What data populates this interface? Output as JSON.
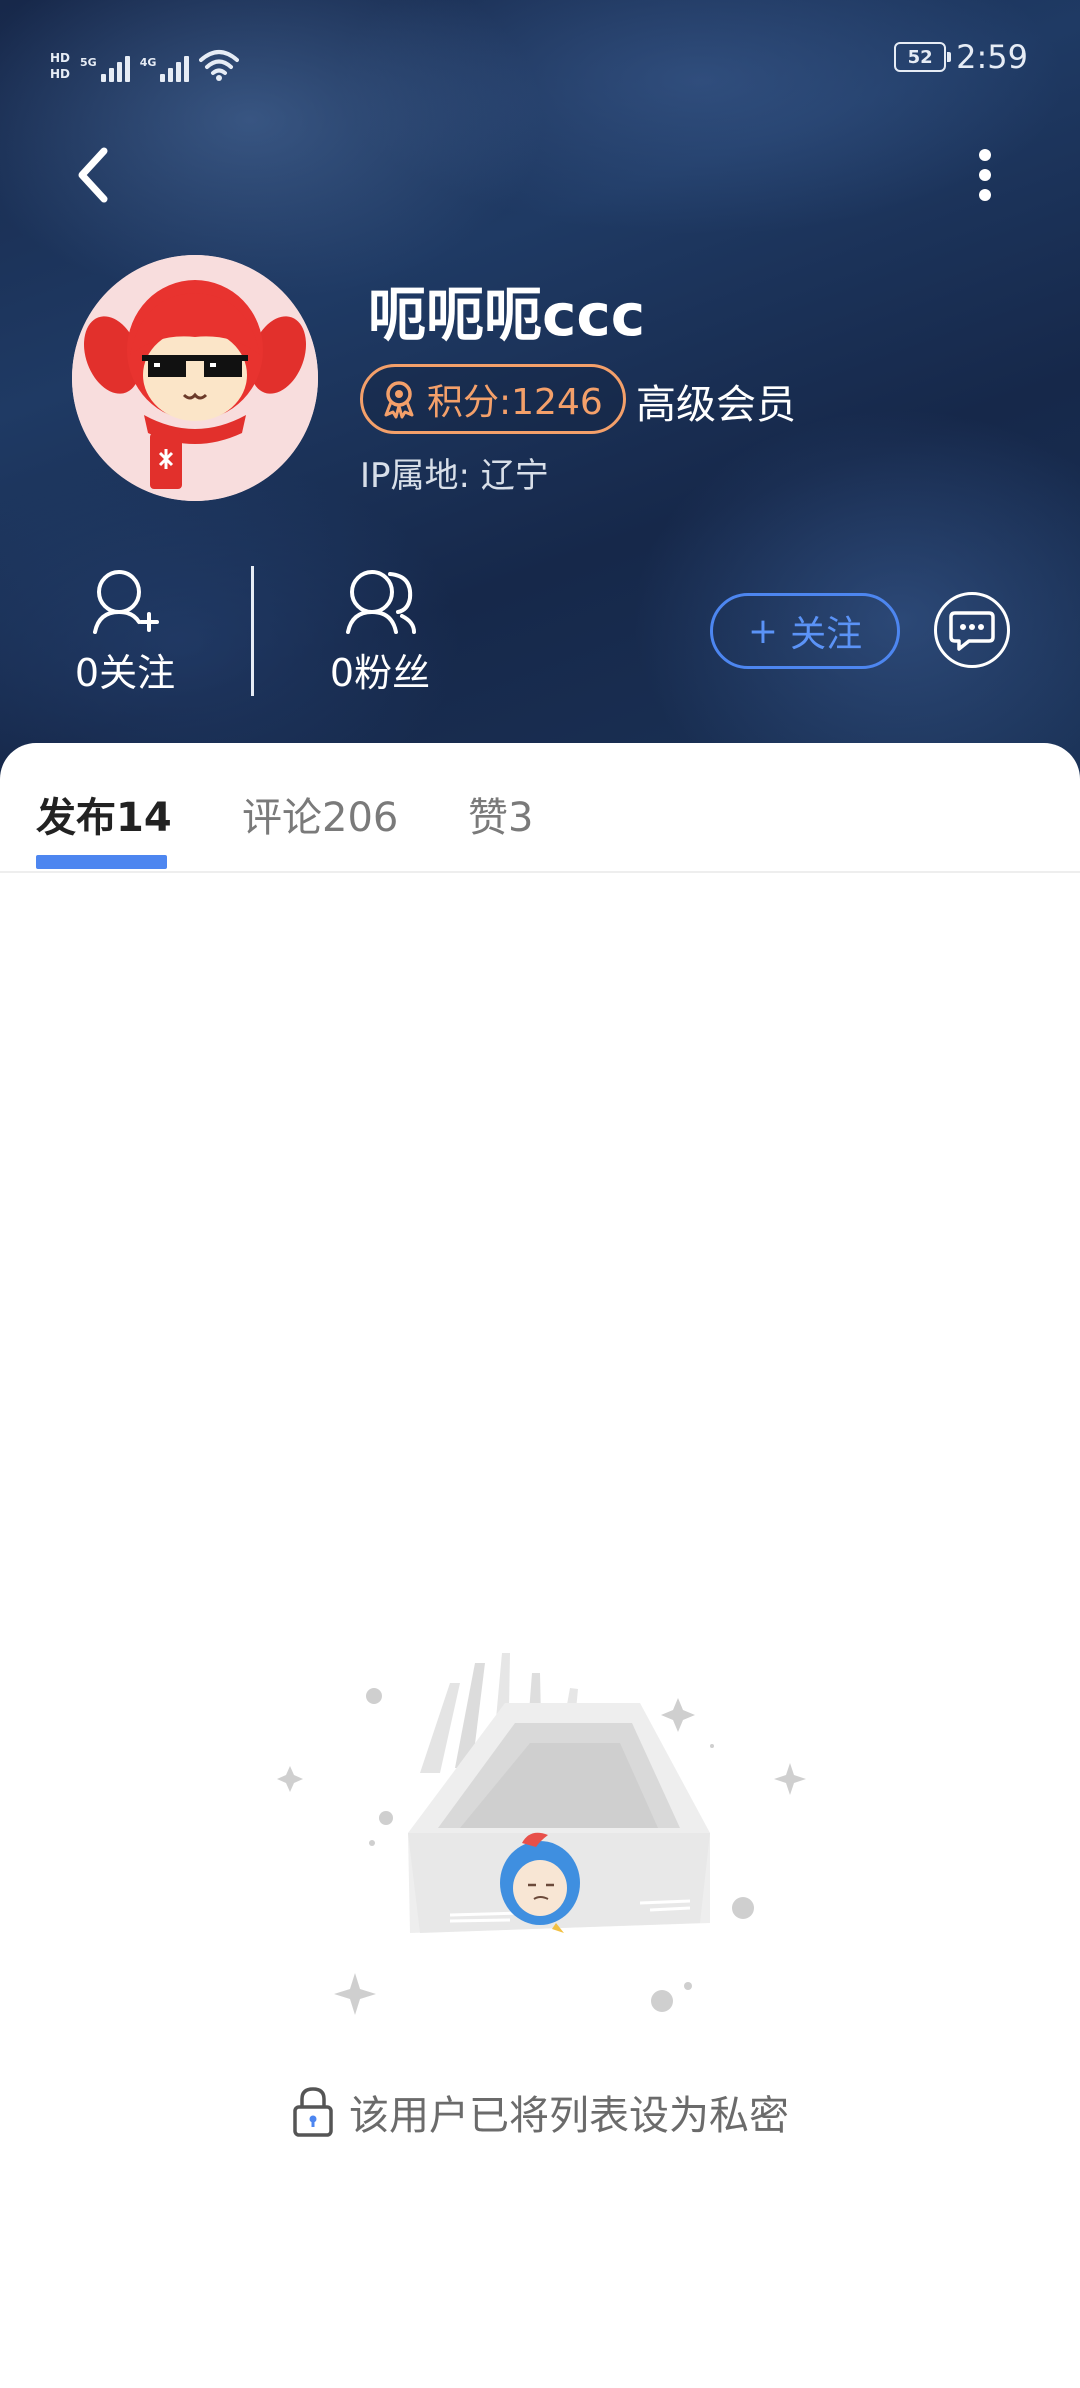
{
  "status_bar": {
    "hd_tags": [
      "HD",
      "HD"
    ],
    "sim1_network": "5G",
    "sim2_network": "4G",
    "battery": "52",
    "time": "2:59",
    "icons": [
      "signal-icon",
      "wifi-icon",
      "battery-icon"
    ]
  },
  "nav": {
    "back_icon": "chevron-left-icon",
    "more_icon": "more-vertical-icon"
  },
  "profile": {
    "username": "呃呃呃ccc",
    "points_label": "积分:1246",
    "member_level": "高级会员",
    "ip_location": "IP属地: 辽宁",
    "avatar_icon": "avatar"
  },
  "stats": {
    "following": "0关注",
    "fans": "0粉丝"
  },
  "actions": {
    "follow_plus": "+",
    "follow_label": "关注",
    "message_icon": "chat-bubble-icon"
  },
  "tabs": [
    {
      "label": "发布14",
      "active": true
    },
    {
      "label": "评论206",
      "active": false
    },
    {
      "label": "赞3",
      "active": false
    }
  ],
  "empty_state": {
    "message": "该用户已将列表设为私密",
    "icon": "lock-icon"
  },
  "colors": {
    "accent": "#4d86f0",
    "points": "#f4a06a",
    "header_dark": "#17284a"
  }
}
